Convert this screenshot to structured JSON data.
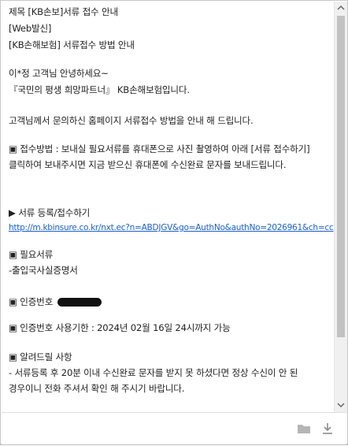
{
  "message": {
    "subject_line": "제목 [KB손보]서류 접수 안내",
    "tag_line": "[Web발신]",
    "header_line": "[KB손해보험] 서류접수 방법 안내",
    "greeting": "이*정 고객님 안녕하세요~",
    "slogan": "『국민의 평생 희망파트너』 KB손해보험입니다.",
    "intro": "고객님께서 문의하신 홈페이지 서류접수 방법을 안내 해 드립니다.",
    "method": "▣ 접수방법 : 보내실 필요서류를 휴대폰으로 사진 촬영하여 아래 [서류 접수하기] 클릭하여 보내주시면 지금 받으신 휴대폰에 수신완료 문자를 보내드립니다.",
    "register_heading": "▶ 서류 등록/접수하기",
    "register_link": "http://m.kbinsure.co.kr/nxt.ec?n=ABDJGV&go=AuthNo&authNo=2026961&ch=cc",
    "required_heading": "▣ 필요서류",
    "required_item": "-출입국사실증명서",
    "auth_label": "▣ 인증번호",
    "auth_deadline": "▣ 인증번호 사용기한 : 2024년 02월 16일 24시까지 가능",
    "notice_heading": "▣ 알려드릴 사항",
    "notice_body": "- 서류등록 후 20분 이내 수신완료 문자를 받지 못 하셨다면 정상 수신이 안 된 경우이니 전화 주셔서 확인 해 주시기 바랍니다."
  },
  "icons": {
    "folder": "folder-icon",
    "download": "download-icon",
    "scroll_up": "chevron-up-icon",
    "scroll_down": "chevron-down-icon"
  },
  "colors": {
    "link": "#1a5fd6",
    "text": "#222222"
  }
}
